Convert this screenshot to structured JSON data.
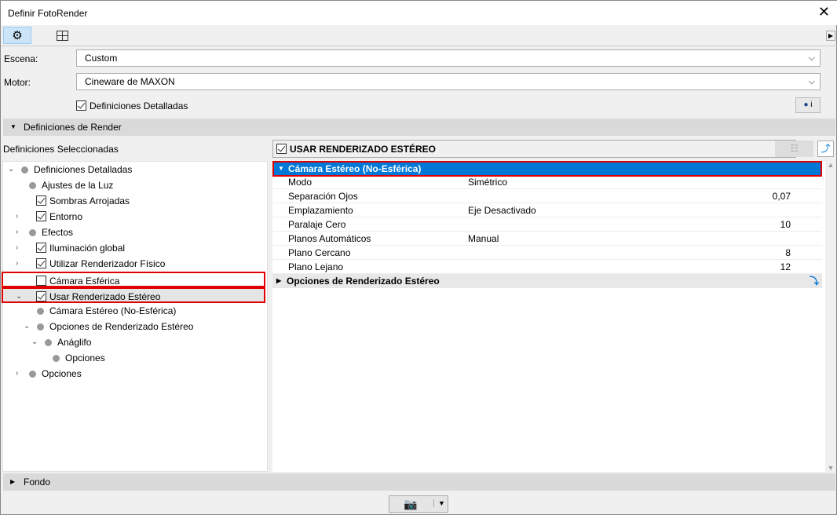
{
  "window": {
    "title": "Definir FotoRender",
    "close": "✕"
  },
  "toolbar": {
    "tabs": [
      {
        "icon": "gear-icon"
      },
      {
        "icon": "grid-icon"
      }
    ]
  },
  "scene": {
    "label": "Escena:",
    "value": "Custom"
  },
  "engine": {
    "label": "Motor:",
    "value": "Cineware de MAXON"
  },
  "detailed": {
    "label": "Definiciones Detalladas",
    "checked": true
  },
  "info_button": "i",
  "render_section": "Definiciones de Render",
  "tree": {
    "header": "Definiciones Seleccionadas",
    "items": [
      {
        "label": "Definiciones Detalladas",
        "level": 0,
        "arrow": "down",
        "mark": "dot"
      },
      {
        "label": "Ajustes de la Luz",
        "level": 1,
        "arrow": "",
        "mark": "dot"
      },
      {
        "label": "Sombras Arrojadas",
        "level": 1,
        "arrow": "",
        "mark": "check"
      },
      {
        "label": "Entorno",
        "level": 1,
        "arrow": "right",
        "mark": "check"
      },
      {
        "label": "Efectos",
        "level": 1,
        "arrow": "right",
        "mark": "dot"
      },
      {
        "label": "Iluminación global",
        "level": 1,
        "arrow": "right",
        "mark": "check"
      },
      {
        "label": "Utilizar Renderizador Físico",
        "level": 1,
        "arrow": "right",
        "mark": "check"
      },
      {
        "label": "Cámara Esférica",
        "level": 1,
        "arrow": "",
        "mark": "box",
        "highlight": true
      },
      {
        "label": "Usar Renderizado Estéreo",
        "level": 1,
        "arrow": "down",
        "mark": "check",
        "highlight": true,
        "selected": true
      },
      {
        "label": "Cámara Estéreo (No-Esférica)",
        "level": 2,
        "arrow": "",
        "mark": "dot"
      },
      {
        "label": "Opciones de Renderizado Estéreo",
        "level": 2,
        "arrow": "down",
        "mark": "dot"
      },
      {
        "label": "Anáglifo",
        "level": 3,
        "arrow": "down",
        "mark": "dot"
      },
      {
        "label": "Opciones",
        "level": 4,
        "arrow": "",
        "mark": "dot"
      },
      {
        "label": "Opciones",
        "level": 1,
        "arrow": "right",
        "mark": "dot"
      }
    ]
  },
  "panel": {
    "title": "USAR RENDERIZADO ESTÉREO",
    "group1": "Cámara Estéreo (No-Esférica)",
    "rows": [
      {
        "key": "Modo",
        "value": "Simétrico",
        "num": ""
      },
      {
        "key": "Separación Ojos",
        "value": "",
        "num": "0,07"
      },
      {
        "key": "Emplazamiento",
        "value": "Eje Desactivado",
        "num": ""
      },
      {
        "key": "Paralaje Cero",
        "value": "",
        "num": "10"
      },
      {
        "key": "Planos Automáticos",
        "value": "Manual",
        "num": ""
      },
      {
        "key": "Plano Cercano",
        "value": "",
        "num": "8"
      },
      {
        "key": "Plano Lejano",
        "value": "",
        "num": "12"
      }
    ],
    "group2": "Opciones de Renderizado Estéreo"
  },
  "bottom_section": "Fondo",
  "colors": {
    "accent": "#0078d7",
    "highlight": "#e00000"
  }
}
